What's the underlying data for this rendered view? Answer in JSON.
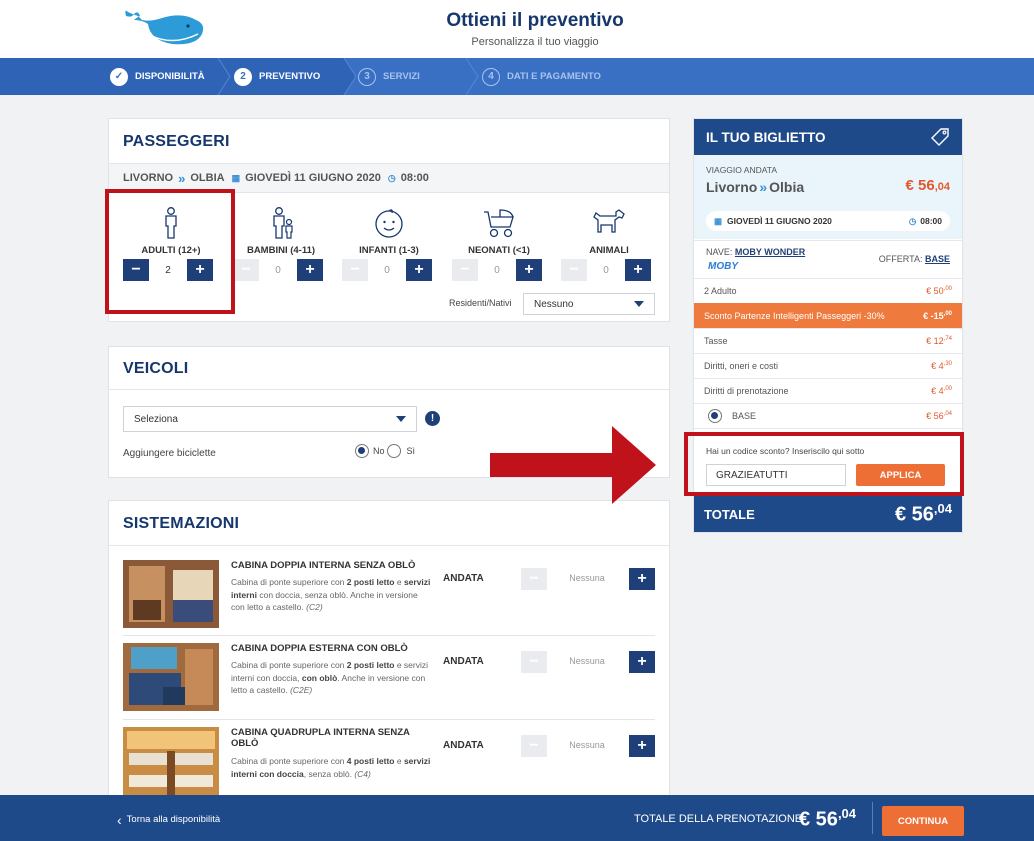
{
  "header": {
    "title": "Ottieni il preventivo",
    "subtitle": "Personalizza il tuo viaggio"
  },
  "steps": [
    {
      "num": "✓",
      "label": "DISPONIBILITÀ",
      "state": "done"
    },
    {
      "num": "2",
      "label": "PREVENTIVO",
      "state": "current"
    },
    {
      "num": "3",
      "label": "SERVIZI",
      "state": "future"
    },
    {
      "num": "4",
      "label": "DATI E PAGAMENTO",
      "state": "future"
    }
  ],
  "passengers": {
    "title": "PASSEGGERI",
    "route": {
      "from": "LIVORNO",
      "to": "OLBIA",
      "date": "GIOVEDÌ 11 GIUGNO 2020",
      "time": "08:00"
    },
    "types": [
      {
        "label": "ADULTI (12+)",
        "value": "2",
        "icon": "adult-icon"
      },
      {
        "label": "BAMBINI (4-11)",
        "value": "0",
        "icon": "child-icon"
      },
      {
        "label": "INFANTI (1-3)",
        "value": "0",
        "icon": "baby-face-icon"
      },
      {
        "label": "NEONATI (<1)",
        "value": "0",
        "icon": "stroller-icon"
      },
      {
        "label": "ANIMALI",
        "value": "0",
        "icon": "dog-icon"
      }
    ],
    "residents_label": "Residenti/Nativi",
    "residents_value": "Nessuno"
  },
  "vehicles": {
    "title": "VEICOLI",
    "select_value": "Seleziona",
    "bikes_label": "Aggiungere biciclette",
    "no_label": "No",
    "yes_label": "Sì",
    "bikes_selected": "No"
  },
  "accommodations": {
    "title": "SISTEMAZIONI",
    "items": [
      {
        "title": "CABINA DOPPIA INTERNA SENZA OBLÒ",
        "d1": "Cabina di ponte superiore con ",
        "d2": "2 posti letto",
        "d3": " e ",
        "d4": "servizi interni",
        "d5": " con doccia, ",
        "d6": "senza oblò",
        "d7": ". Anche in versione con letto a castello. ",
        "code": "(C2)",
        "direction": "ANDATA",
        "value": "Nessuna"
      },
      {
        "title": "CABINA DOPPIA ESTERNA CON OBLÒ",
        "d1": "Cabina di ponte superiore con ",
        "d2": "2 posti letto",
        "d3": " e servizi interni con doccia, ",
        "d4": "con oblò",
        "d5": ". Anche in versione con letto a castello. ",
        "code": "(C2E)",
        "direction": "ANDATA",
        "value": "Nessuna"
      },
      {
        "title": "CABINA QUADRUPLA INTERNA SENZA OBLÒ",
        "d1": "Cabina di ponte superiore con ",
        "d2": "4 posti letto",
        "d3": " e ",
        "d4": "servizi interni con doccia",
        "d5": ", senza oblò. ",
        "code": "(C4)",
        "direction": "ANDATA",
        "value": "Nessuna"
      }
    ]
  },
  "ticket": {
    "title": "IL TUO BIGLIETTO",
    "trip_label": "VIAGGIO ANDATA",
    "from": "Livorno",
    "to": "Olbia",
    "price_main": "€ 56",
    "price_dec": ",04",
    "date": "GIOVEDÌ 11 GIUGNO 2020",
    "time": "08:00",
    "ship_label": "NAVE:",
    "ship_name": "MOBY WONDER",
    "brand": "MOBY",
    "offer_label": "OFFERTA:",
    "offer_name": "BASE",
    "rows": [
      {
        "label": "2 Adulto",
        "amt": "€ 50",
        "dec": ",00"
      },
      {
        "label": "Sconto Partenze Intelligenti Passeggeri -30%",
        "amt": "€ -15",
        "dec": ",00"
      },
      {
        "label": "Tasse",
        "amt": "€ 12",
        "dec": ",74"
      },
      {
        "label": "Diritti, oneri e costi",
        "amt": "€ 4",
        "dec": ",30"
      },
      {
        "label": "Diritti di prenotazione",
        "amt": "€ 4",
        "dec": ",00"
      },
      {
        "label": "BASE",
        "amt": "€ 56",
        "dec": ",04"
      }
    ],
    "promo_prompt": "Hai un codice sconto? Inseriscilo qui sotto",
    "promo_code": "GRAZIEATUTTI",
    "apply_label": "APPLICA",
    "total_label": "TOTALE",
    "total_main": "€ 56",
    "total_dec": ",04"
  },
  "footer": {
    "back_label": "Torna alla disponibilità",
    "total_label": "TOTALE DELLA PRENOTAZIONE",
    "total_main": "€ 56",
    "total_dec": ",04",
    "continue_label": "CONTINUA"
  },
  "colors": {
    "navy": "#1f4a8a",
    "step_blue": "#3a70c4",
    "orange": "#ee6f35",
    "highlight_red": "#c0121b"
  }
}
